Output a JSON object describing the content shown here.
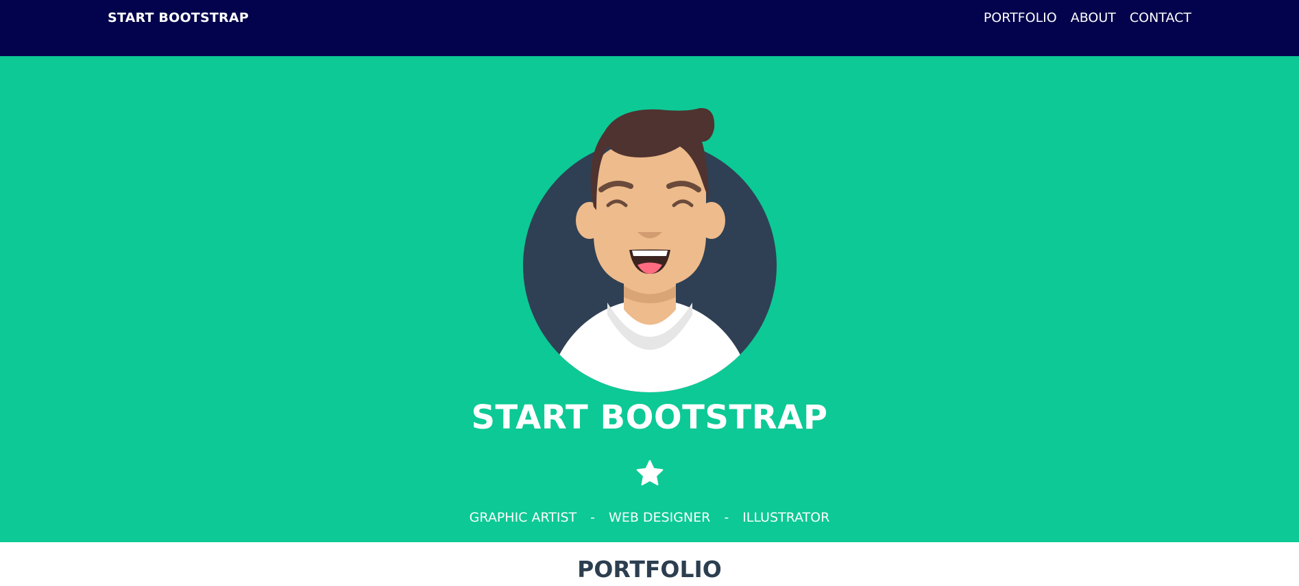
{
  "navbar": {
    "brand": "START BOOTSTRAP",
    "links": [
      {
        "label": "PORTFOLIO"
      },
      {
        "label": "ABOUT"
      },
      {
        "label": "CONTACT"
      }
    ],
    "background": "#03034d"
  },
  "masthead": {
    "title": "START BOOTSTRAP",
    "icon": "star-icon",
    "subtitle_items": [
      "GRAPHIC ARTIST",
      "WEB DESIGNER",
      "ILLUSTRATOR"
    ],
    "separator": "-",
    "background": "#0dc995"
  },
  "portfolio": {
    "heading": "PORTFOLIO"
  }
}
